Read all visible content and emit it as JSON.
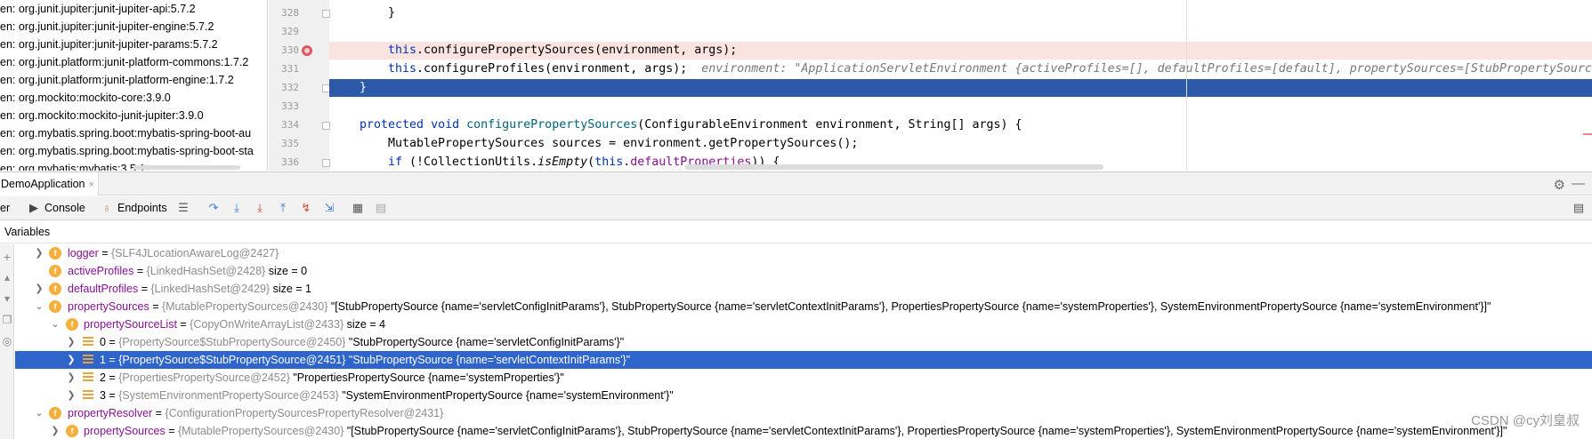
{
  "dependencies": [
    "en: org.junit.jupiter:junit-jupiter-api:5.7.2",
    "en: org.junit.jupiter:junit-jupiter-engine:5.7.2",
    "en: org.junit.jupiter:junit-jupiter-params:5.7.2",
    "en: org.junit.platform:junit-platform-commons:1.7.2",
    "en: org.junit.platform:junit-platform-engine:1.7.2",
    "en: org.mockito:mockito-core:3.9.0",
    "en: org.mockito:mockito-junit-jupiter:3.9.0",
    "en: org.mybatis.spring.boot:mybatis-spring-boot-au",
    "en: org.mybatis.spring.boot:mybatis-spring-boot-sta",
    "en: org.mybatis:mybatis:3.5.1"
  ],
  "editor": {
    "line_numbers": [
      "328",
      "329",
      "330",
      "331",
      "332",
      "333",
      "334",
      "335",
      "336"
    ],
    "lines": {
      "l328": "}",
      "l330_this": "this",
      "l330_rest": ".configurePropertySources(environment, args);",
      "l331_this": "this",
      "l331_rest": ".configureProfiles(environment, args);",
      "l331_hint": "environment: \"ApplicationServletEnvironment {activeProfiles=[], defaultProfiles=[default], propertySources=[StubPropertySource {name='servletConfig",
      "l332": "}",
      "l334_kw1": "protected",
      "l334_kw2": "void",
      "l334_method": "configurePropertySources",
      "l334_rest1": "(ConfigurableEnvironment environment, String[] args) {",
      "l335": "MutablePropertySources sources = environment.getPropertySources();",
      "l336_kw": "if",
      "l336_a": " (!CollectionUtils.",
      "l336_method": "isEmpty",
      "l336_b": "(",
      "l336_this": "this",
      "l336_c": ".",
      "l336_field": "defaultProperties",
      "l336_d": ")) {"
    }
  },
  "debug": {
    "tab_label": "DemoApplication",
    "tab_close": "×",
    "toolbar": {
      "debugger_label": "er",
      "console_label": "Console",
      "endpoints_label": "Endpoints"
    },
    "variables_label": "Variables"
  },
  "variables": [
    {
      "name": "logger",
      "type": "{SLF4JLocationAwareLog@2427}",
      "value": ""
    },
    {
      "name": "activeProfiles",
      "type": "{LinkedHashSet@2428}",
      "value": " size = 0"
    },
    {
      "name": "defaultProfiles",
      "type": "{LinkedHashSet@2429}",
      "value": " size = 1"
    },
    {
      "name": "propertySources",
      "type": "{MutablePropertySources@2430}",
      "value": " \"[StubPropertySource {name='servletConfigInitParams'}, StubPropertySource {name='servletContextInitParams'}, PropertiesPropertySource {name='systemProperties'}, SystemEnvironmentPropertySource {name='systemEnvironment'}]\""
    },
    {
      "name": "propertySourceList",
      "type": "{CopyOnWriteArrayList@2433}",
      "value": " size = 4"
    },
    {
      "name": "0",
      "type": "{PropertySource$StubPropertySource@2450}",
      "value": " \"StubPropertySource {name='servletConfigInitParams'}\""
    },
    {
      "name": "1",
      "type": "{PropertySource$StubPropertySource@2451}",
      "value": " \"StubPropertySource {name='servletContextInitParams'}\""
    },
    {
      "name": "2",
      "type": "{PropertiesPropertySource@2452}",
      "value": " \"PropertiesPropertySource {name='systemProperties'}\""
    },
    {
      "name": "3",
      "type": "{SystemEnvironmentPropertySource@2453}",
      "value": " \"SystemEnvironmentPropertySource {name='systemEnvironment'}\""
    },
    {
      "name": "propertyResolver",
      "type": "{ConfigurationPropertySourcesPropertyResolver@2431}",
      "value": ""
    },
    {
      "name": "propertySources",
      "type": "{MutablePropertySources@2430}",
      "value": " \"[StubPropertySource {name='servletConfigInitParams'}, StubPropertySource {name='servletContextInitParams'}, PropertiesPropertySource {name='systemProperties'}, SystemEnvironmentPropertySource {name='systemEnvironment'}]\""
    }
  ],
  "eq": " = ",
  "watermark": "CSDN @cy刘皇叔",
  "colors": {
    "execution_line": "#2c59a8",
    "breakpoint_line": "#fbe4e0",
    "selected_row": "#2f65ca",
    "keyword": "#0033b3",
    "field_name": "#871094"
  }
}
